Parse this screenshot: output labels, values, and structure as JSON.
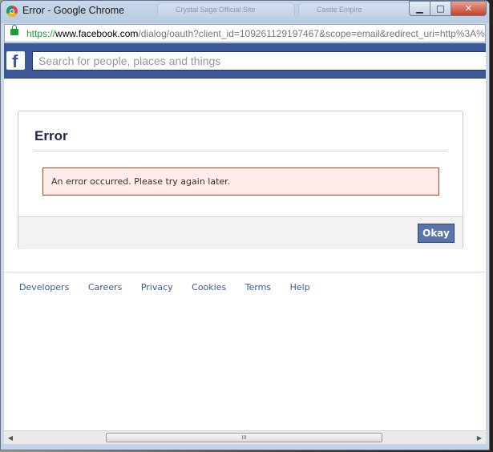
{
  "window": {
    "title": "Error - Google Chrome",
    "background_tabs": [
      "Crystal Saga Official Site",
      "Castle Empire"
    ]
  },
  "addressbar": {
    "scheme": "https",
    "separator": "://",
    "host": "www.facebook.com",
    "path": "/dialog/oauth?client_id=109261129197467&scope=email&redirect_uri=http%3A%"
  },
  "header": {
    "logo_letter": "f",
    "search_placeholder": "Search for people, places and things"
  },
  "dialog": {
    "title": "Error",
    "message": "An error occurred. Please try again later.",
    "okay_label": "Okay"
  },
  "footer": {
    "links": [
      "Developers",
      "Careers",
      "Privacy",
      "Cookies",
      "Terms",
      "Help"
    ]
  },
  "scrollbar": {
    "thumb_grip": "III"
  },
  "colors": {
    "brand": "#3b5998",
    "error_bg": "#ffebe8",
    "error_border": "#dd3c10",
    "secure_green": "#1d9e2d"
  }
}
